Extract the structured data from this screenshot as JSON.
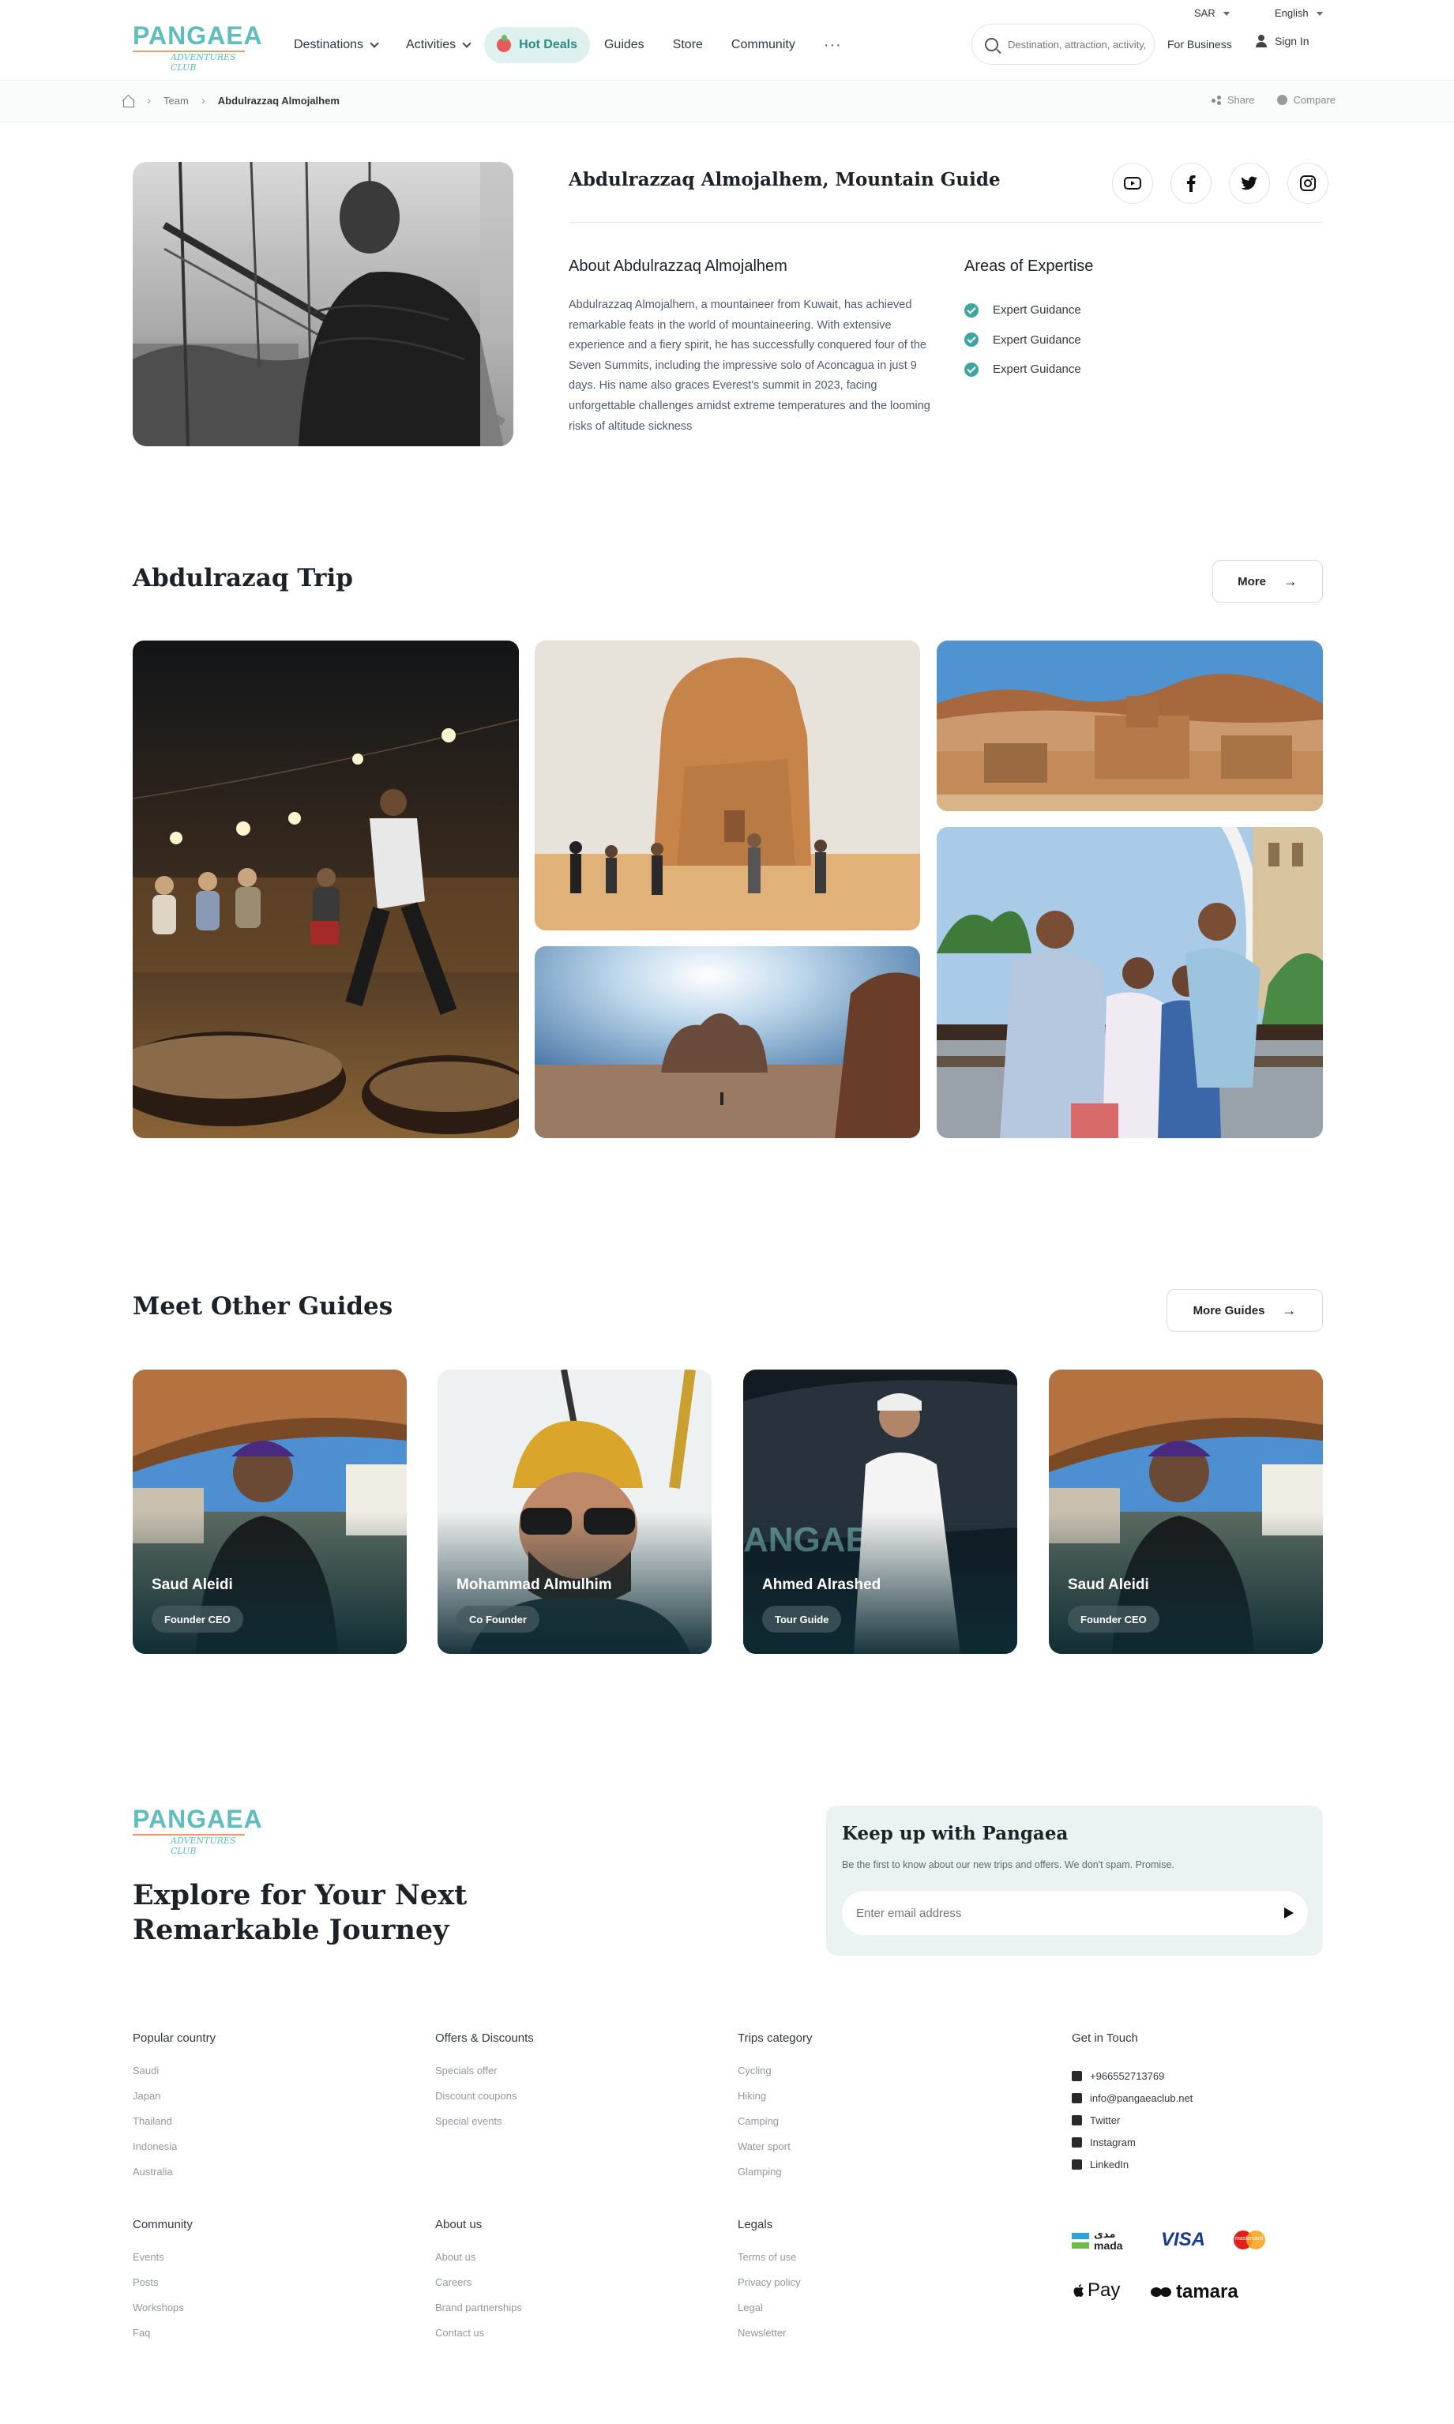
{
  "header": {
    "logo_word": "PANGAEA",
    "logo_sub": "ADVENTURES CLUB",
    "currency": "SAR",
    "language": "English",
    "nav": [
      {
        "label": "Destinations",
        "has_dropdown": true
      },
      {
        "label": "Activities",
        "has_dropdown": true
      },
      {
        "label": "Hot Deals",
        "highlight": true
      },
      {
        "label": "Guides"
      },
      {
        "label": "Store"
      },
      {
        "label": "Community"
      }
    ],
    "more": "···",
    "search_placeholder": "Destination, attraction, activity,",
    "for_business": "For Business",
    "sign_in": "Sign In"
  },
  "breadcrumb": {
    "items": [
      "Team",
      "Abdulrazzaq Almojalhem"
    ],
    "share": "Share",
    "compare": "Compare"
  },
  "profile": {
    "title": "Abdulrazzaq Almojalhem, Mountain Guide",
    "socials": [
      "youtube-icon",
      "facebook-icon",
      "twitter-icon",
      "instagram-icon"
    ],
    "about_heading": "About Abdulrazzaq Almojalhem",
    "about_text": "Abdulrazzaq Almojalhem, a mountaineer from Kuwait, has achieved remarkable feats in the world of mountaineering. With extensive experience and a fiery spirit, he has successfully conquered four of the Seven Summits, including the impressive solo of Aconcagua in just 9 days. His name also graces Everest's summit in 2023, facing unforgettable challenges amidst extreme temperatures and the looming risks of altitude sickness",
    "expertise_heading": "Areas of Expertise",
    "expertise": [
      "Expert Guidance",
      "Expert Guidance",
      "Expert Guidance"
    ]
  },
  "trips": {
    "title": "Abdulrazaq Trip",
    "more_label": "More",
    "arrow": "→"
  },
  "guides": {
    "title": "Meet Other Guides",
    "more_label": "More Guides",
    "arrow": "→",
    "cards": [
      {
        "name": "Saud Aleidi",
        "role": "Founder CEO"
      },
      {
        "name": "Mohammad Almulhim",
        "role": "Co Founder"
      },
      {
        "name": "Ahmed Alrashed",
        "role": "Tour Guide"
      },
      {
        "name": "Saud Aleidi",
        "role": "Founder CEO"
      }
    ]
  },
  "footer": {
    "title": "Explore for Your Next Remarkable Journey",
    "newsletter": {
      "title": "Keep up with Pangaea",
      "subtitle": "Be the first to know about our new trips and offers. We don't spam. Promise.",
      "placeholder": "Enter email address"
    },
    "columns": [
      {
        "heading": "Popular country",
        "links": [
          "Saudi",
          "Japan",
          "Thailand",
          "Indonesia",
          "Australia"
        ]
      },
      {
        "heading": "Offers & Discounts",
        "links": [
          "Specials offer",
          "Discount coupons",
          "Special events"
        ]
      },
      {
        "heading": "Trips category",
        "links": [
          "Cycling",
          "Hiking",
          "Camping",
          "Water sport",
          "Glamping"
        ]
      },
      {
        "heading": "Community",
        "links": [
          "Events",
          "Posts",
          "Workshops",
          "Faq"
        ]
      },
      {
        "heading": "About us",
        "links": [
          "About us",
          "Careers",
          "Brand partnerships",
          "Contact us"
        ]
      },
      {
        "heading": "Legals",
        "links": [
          "Terms of use",
          "Privacy policy",
          "Legal",
          "Newsletter"
        ]
      }
    ],
    "contact": {
      "heading": "Get in Touch",
      "items": [
        {
          "icon": "phone-icon",
          "label": "+966552713769"
        },
        {
          "icon": "mail-icon",
          "label": "info@pangaeaclub.net"
        },
        {
          "icon": "twitter-icon",
          "label": "Twitter"
        },
        {
          "icon": "instagram-icon",
          "label": "Instagram"
        },
        {
          "icon": "linkedin-icon",
          "label": "LinkedIn"
        }
      ]
    },
    "payments": {
      "mada_ar": "مدى",
      "mada": "mada",
      "visa": "VISA",
      "mastercard": "mastercard",
      "applepay": "Pay",
      "tamara": "tamara"
    }
  },
  "colors": {
    "accent": "#3fa59f",
    "logo": "#5fbdbd",
    "hot_deals_bg": "#dff1ef",
    "newsletter_bg": "#eaf3f1"
  }
}
